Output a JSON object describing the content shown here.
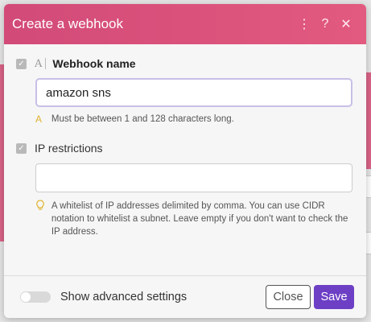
{
  "dialog": {
    "title": "Create a webhook",
    "header_icons": {
      "menu": "⋮",
      "help": "?",
      "close": "✕"
    }
  },
  "fields": {
    "webhook_name": {
      "type_glyph": "A",
      "label": "Webhook name",
      "value": "amazon sns",
      "hint_glyph": "A",
      "hint": "Must be between 1 and 128 characters long."
    },
    "ip_restrictions": {
      "label": "IP restrictions",
      "value": "",
      "hint": "A whitelist of IP addresses delimited by comma. You can use CIDR notation to whitelist a subnet. Leave empty if you don't want to check the IP address."
    }
  },
  "footer": {
    "toggle_label": "Show advanced settings",
    "close_label": "Close",
    "save_label": "Save"
  },
  "colors": {
    "header": "#d8507b",
    "save": "#6d3fc5"
  }
}
